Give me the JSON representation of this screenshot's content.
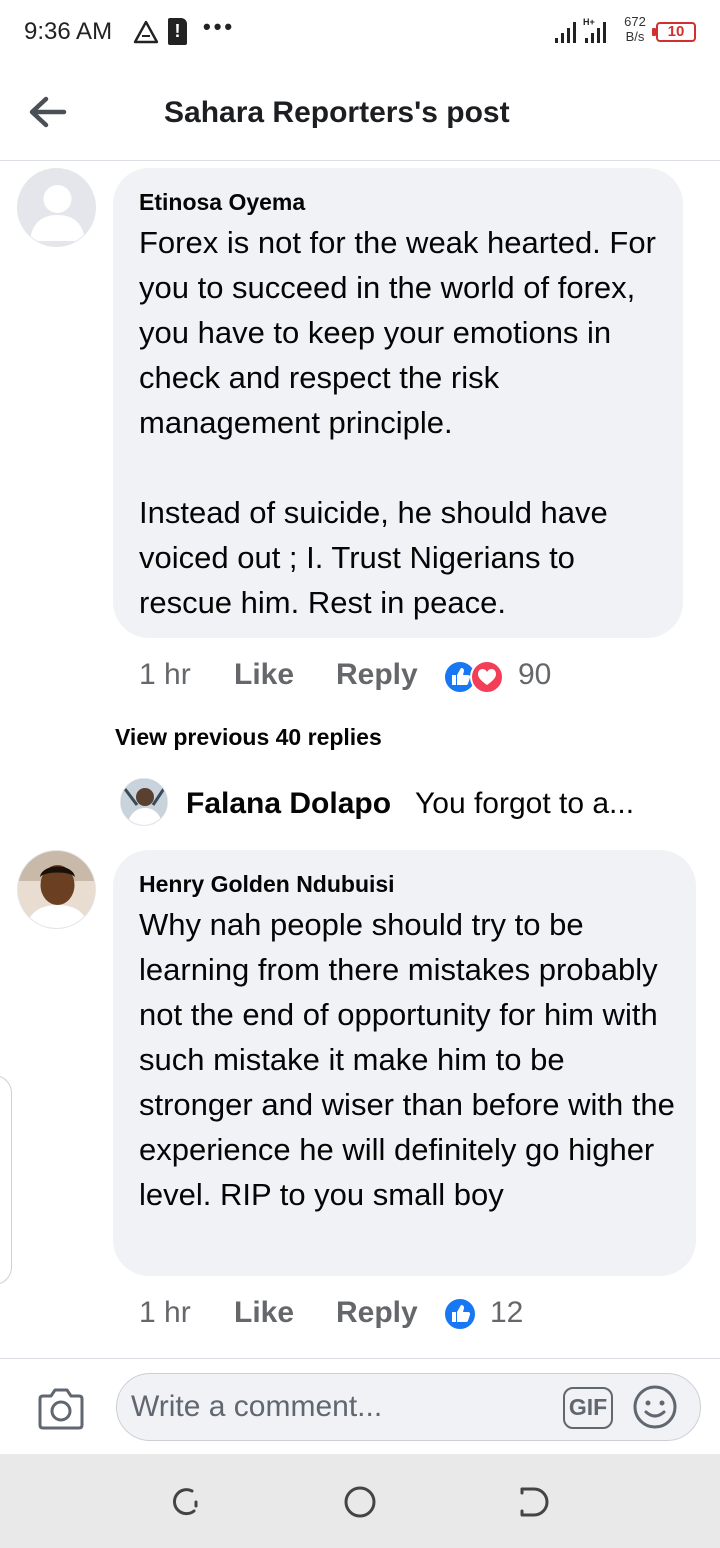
{
  "status_bar": {
    "time": "9:36 AM",
    "sd_label": "!",
    "dots": "•••",
    "net_type": "H+",
    "speed_value": "672",
    "speed_unit": "B/s",
    "battery": "10"
  },
  "header": {
    "title": "Sahara Reporters's post"
  },
  "comments": [
    {
      "author": "Etinosa Oyema",
      "text": "Forex is not for the weak hearted. For you to succeed in the world of forex, you have to keep your emotions in check and respect the risk management principle.\n\nInstead of suicide, he should have voiced out ; I. Trust Nigerians to rescue him. Rest in peace.",
      "time": "1 hr",
      "like_label": "Like",
      "reply_label": "Reply",
      "reactions": [
        "like",
        "love"
      ],
      "reaction_count": "90"
    },
    {
      "author": "Henry Golden Ndubuisi",
      "text": "Why nah people should try to be learning from there mistakes probably not the end of opportunity for him with such mistake it make him to be stronger and wiser than before with the experience he will definitely go higher level. RIP to you small boy",
      "time": "1 hr",
      "like_label": "Like",
      "reply_label": "Reply",
      "reactions": [
        "like"
      ],
      "reaction_count": "12"
    }
  ],
  "replies_section": {
    "view_previous": "View previous 40 replies",
    "preview": {
      "name": "Falana Dolapo",
      "text": "You forgot to a..."
    }
  },
  "composer": {
    "placeholder": "Write a comment...",
    "gif_label": "GIF"
  },
  "colors": {
    "bubble": "#f0f2f5",
    "secondary_text": "#65676b",
    "like_blue": "#1877f2",
    "love_red": "#f33e58",
    "battery_red": "#d32f2f"
  },
  "icons": [
    "back-arrow-icon",
    "camera-icon",
    "gif-icon",
    "emoji-icon",
    "like-reaction-icon",
    "love-reaction-icon",
    "recents-icon",
    "home-icon",
    "back-nav-icon"
  ]
}
